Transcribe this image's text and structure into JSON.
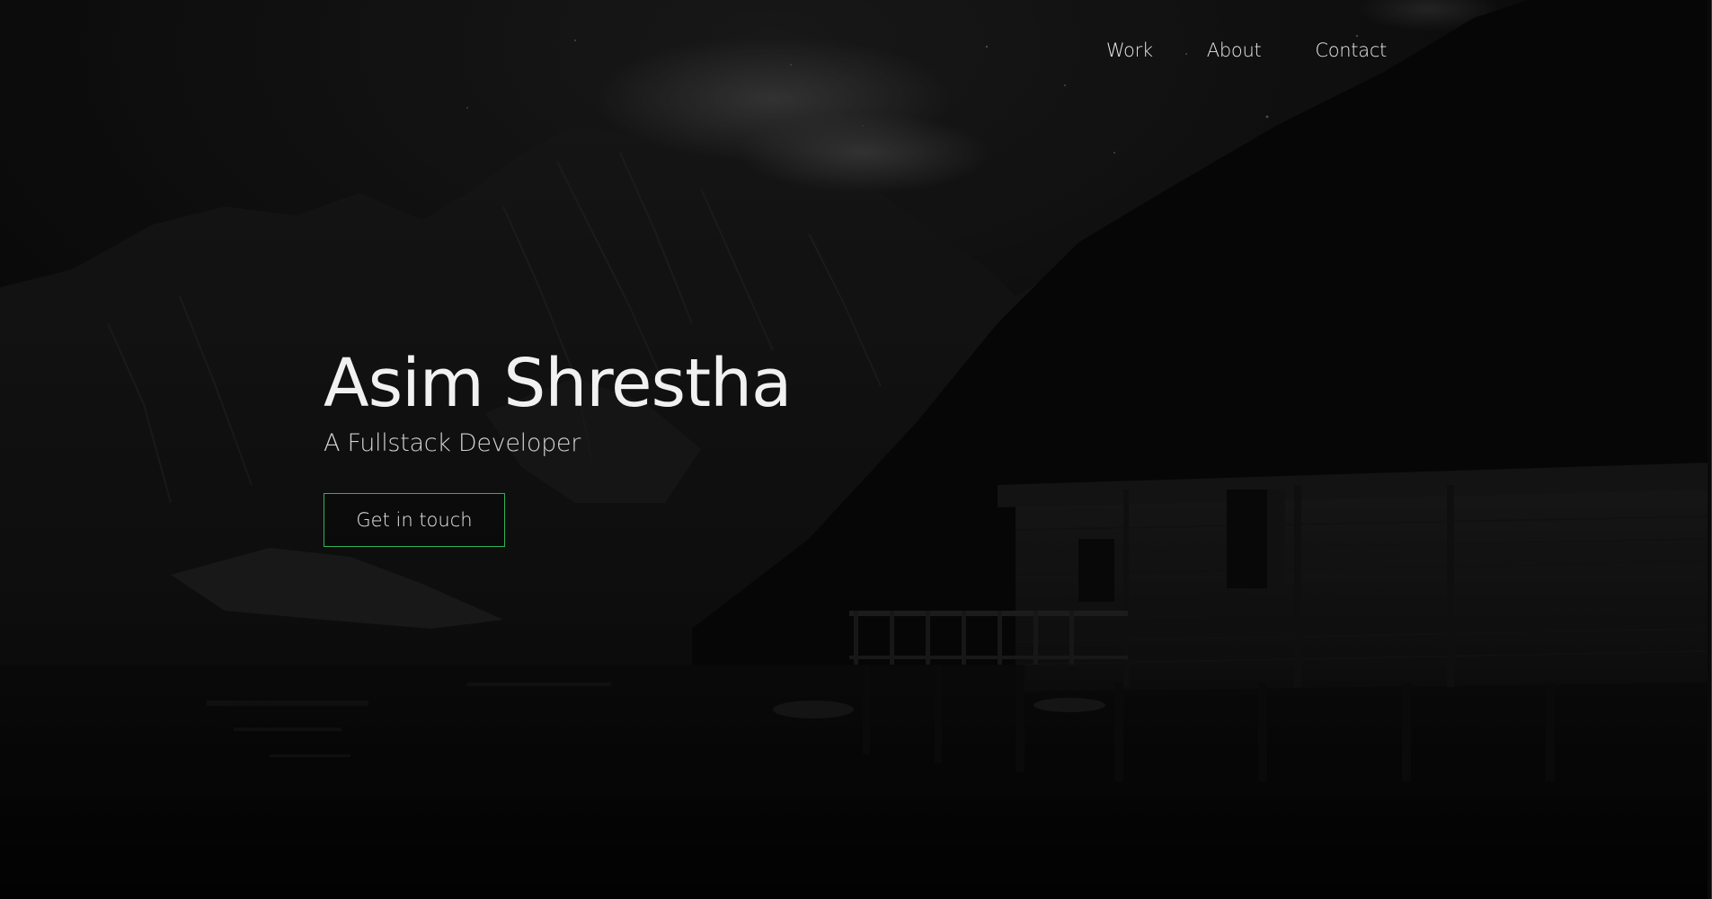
{
  "nav": {
    "items": [
      {
        "label": "Work"
      },
      {
        "label": "About"
      },
      {
        "label": "Contact"
      }
    ]
  },
  "hero": {
    "name": "Asim Shrestha",
    "subtitle": "A Fullstack Developer",
    "cta_label": "Get in touch"
  },
  "theme": {
    "background": "#050505",
    "text": "#f1f1f1",
    "accent": "#2fb25a"
  },
  "background_image": {
    "content": "dark night landscape with mountains, clouds, lake reflection and wooden boathouse"
  }
}
